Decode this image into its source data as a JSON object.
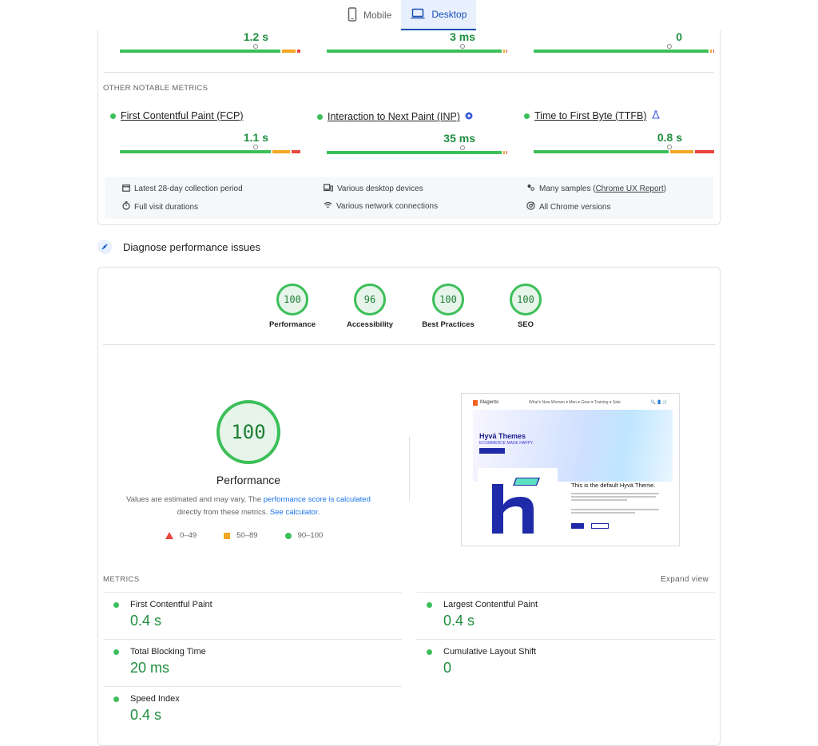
{
  "tabs": [
    {
      "label": "Mobile",
      "icon": "phone-icon"
    },
    {
      "label": "Desktop",
      "icon": "laptop-icon",
      "active": true
    }
  ],
  "top_bars": [
    {
      "value": "1.2 s",
      "marker": 0.75,
      "split": [
        0.905,
        0.075,
        0.02
      ]
    },
    {
      "value": "3 ms",
      "marker": 0.75,
      "split": [
        0.985,
        0.01,
        0.005
      ]
    },
    {
      "value": "0",
      "marker": 0.75,
      "split": [
        0.985,
        0.01,
        0.005
      ]
    }
  ],
  "other_notable": {
    "heading": "OTHER NOTABLE METRICS",
    "items": [
      {
        "label": "First Contentful Paint (FCP)",
        "value": "1.1 s",
        "marker": 0.75,
        "split": [
          0.85,
          0.1,
          0.05
        ],
        "badge": ""
      },
      {
        "label": "Interaction to Next Paint (INP)",
        "value": "35 ms",
        "marker": 0.75,
        "split": [
          0.985,
          0.01,
          0.005
        ],
        "badge": "info-badge-icon"
      },
      {
        "label": "Time to First Byte (TTFB)",
        "value": "0.8 s",
        "marker": 0.75,
        "split": [
          0.76,
          0.13,
          0.11
        ],
        "badge": "flask-icon"
      }
    ]
  },
  "collection_info": {
    "period": "Latest 28-day collection period",
    "visit": "Full visit durations",
    "devices": "Various desktop devices",
    "network": "Various network connections",
    "samples_prefix": "Many samples (",
    "samples_link": "Chrome UX Report",
    "samples_suffix": ")",
    "versions": "All Chrome versions"
  },
  "diagnose": {
    "title": "Diagnose performance issues"
  },
  "category_scores": [
    {
      "score": "100",
      "label": "Performance"
    },
    {
      "score": "96",
      "label": "Accessibility"
    },
    {
      "score": "100",
      "label": "Best Practices"
    },
    {
      "score": "100",
      "label": "SEO"
    }
  ],
  "performance": {
    "score": "100",
    "title": "Performance",
    "note_a": "Values are estimated and may vary. The ",
    "note_link1": "performance score is calculated",
    "note_b": "directly from these metrics. ",
    "note_link2": "See calculator."
  },
  "legend": [
    {
      "range": "0–49",
      "shape": "triangle",
      "color": "#e8453c"
    },
    {
      "range": "50–89",
      "shape": "square",
      "color": "#f5a623"
    },
    {
      "range": "90–100",
      "shape": "circle",
      "color": "#3cbf59"
    }
  ],
  "thumbnail": {
    "logo_text": "Magento",
    "nav_items": "What's New   Women ▾   Men ▾   Gear ▾   Training ▾   Sale",
    "nav_icons": "🔍 👤 🛒",
    "hero_title": "Hyvä Themes",
    "hero_sub": "ECOMMERCE MADE HAPPY.",
    "page_title": "This is the default Hyvä Theme."
  },
  "metrics": {
    "heading": "METRICS",
    "expand": "Expand view",
    "items": [
      {
        "name": "First Contentful Paint",
        "value": "0.4 s"
      },
      {
        "name": "Largest Contentful Paint",
        "value": "0.4 s"
      },
      {
        "name": "Total Blocking Time",
        "value": "20 ms"
      },
      {
        "name": "Cumulative Layout Shift",
        "value": "0"
      },
      {
        "name": "Speed Index",
        "value": "0.4 s"
      }
    ]
  },
  "colors": {
    "good": "#3cbf59",
    "average": "#f5a623",
    "poor": "#e8453c",
    "accent": "#1a4fb4"
  }
}
